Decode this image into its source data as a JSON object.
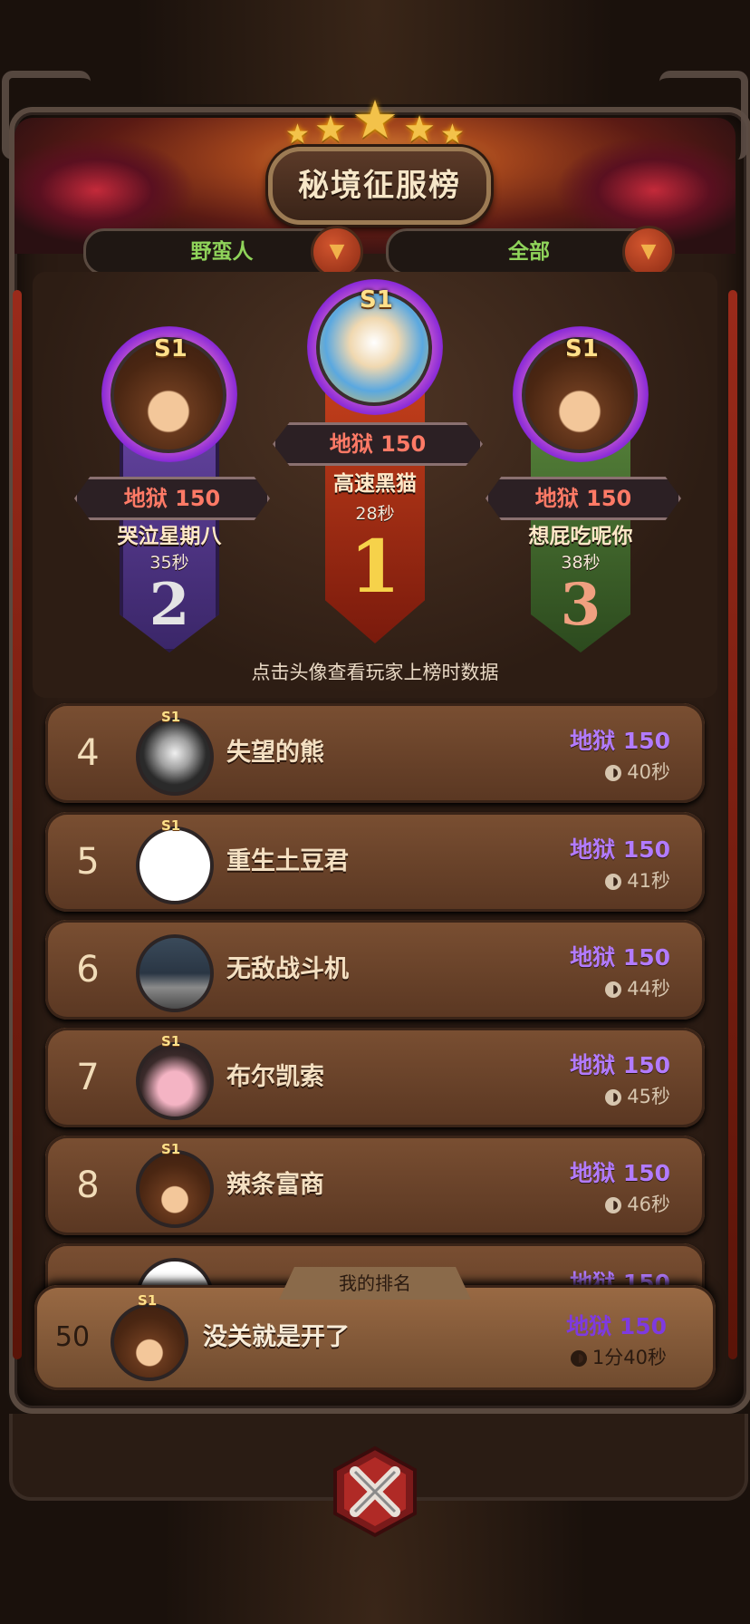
{
  "title": "秘境征服榜",
  "filters": {
    "class": "野蛮人",
    "scope": "全部"
  },
  "hint": "点击头像查看玩家上榜时数据",
  "podium": [
    {
      "rank": "2",
      "season": "S1",
      "level": "地狱 150",
      "name": "哭泣星期八",
      "time": "35秒",
      "color": "#e4e4e4"
    },
    {
      "rank": "1",
      "season": "S1",
      "level": "地狱 150",
      "name": "高速黑猫",
      "time": "28秒",
      "color": "#f6d24a"
    },
    {
      "rank": "3",
      "season": "S1",
      "level": "地狱 150",
      "name": "想屁吃呢你",
      "time": "38秒",
      "color": "#f0a080"
    }
  ],
  "list": [
    {
      "rank": "4",
      "season": "S1",
      "name": "失望的熊",
      "level": "地狱 150",
      "time": "40秒",
      "avatar": "dark-warrior-avatar"
    },
    {
      "rank": "5",
      "season": "S1",
      "name": "重生土豆君",
      "level": "地狱 150",
      "time": "41秒",
      "avatar": "blank-avatar"
    },
    {
      "rank": "6",
      "season": "",
      "name": "无敌战斗机",
      "level": "地狱 150",
      "time": "44秒",
      "avatar": "laptop-avatar"
    },
    {
      "rank": "7",
      "season": "S1",
      "name": "布尔凯索",
      "level": "地狱 150",
      "time": "45秒",
      "avatar": "cow-avatar"
    },
    {
      "rank": "8",
      "season": "S1",
      "name": "辣条富商",
      "level": "地狱 150",
      "time": "46秒",
      "avatar": "bear-avatar"
    },
    {
      "rank": "",
      "season": "",
      "name": "",
      "level": "地狱 150",
      "time": "",
      "avatar": "partial-avatar"
    }
  ],
  "my_rank": {
    "label": "我的排名",
    "rank": "50",
    "season": "S1",
    "name": "没关就是开了",
    "level": "地狱 150",
    "time": "1分40秒"
  },
  "colors": {
    "level_purple": "#b27bff",
    "filter_green": "#8fd35a",
    "plate_red": "#ff7a66"
  }
}
